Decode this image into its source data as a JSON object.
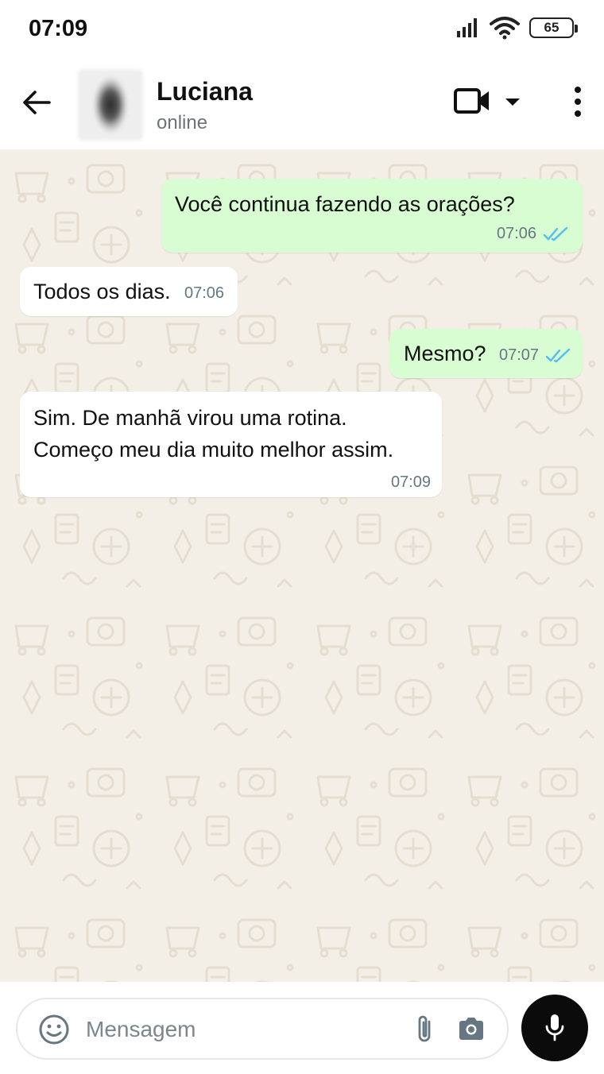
{
  "status_bar": {
    "time": "07:09",
    "battery": "65"
  },
  "header": {
    "contact_name": "Luciana",
    "contact_status": "online"
  },
  "messages": [
    {
      "direction": "out",
      "text": "Você continua fazendo as orações?",
      "time": "07:06",
      "read": true
    },
    {
      "direction": "in",
      "text": "Todos os dias.",
      "time": "07:06"
    },
    {
      "direction": "out",
      "text": "Mesmo?",
      "time": "07:07",
      "read": true
    },
    {
      "direction": "in",
      "lines": [
        "Sim. De manhã virou uma rotina.",
        "Começo meu dia muito melhor assim."
      ],
      "time": "07:09"
    }
  ],
  "composer": {
    "placeholder": "Mensagem"
  },
  "colors": {
    "outgoing_bubble": "#d9fdd3",
    "incoming_bubble": "#ffffff",
    "chat_background": "#f3efe6",
    "read_ticks": "#53bdeb"
  },
  "icons": [
    "signal-icon",
    "wifi-icon",
    "battery-icon",
    "back-arrow-icon",
    "video-call-icon",
    "dropdown-icon",
    "more-vert-icon",
    "emoji-icon",
    "attach-icon",
    "camera-icon",
    "mic-icon"
  ]
}
